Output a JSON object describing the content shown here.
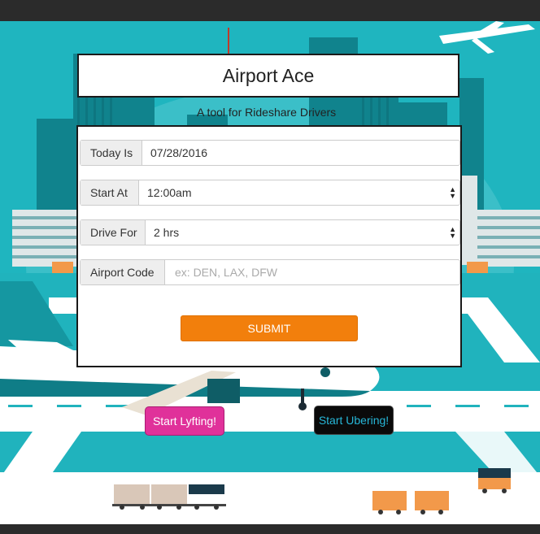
{
  "app": {
    "title": "Airport Ace",
    "subtitle": "A tool for Rideshare Drivers"
  },
  "form": {
    "today": {
      "label": "Today Is",
      "value": "07/28/2016"
    },
    "start": {
      "label": "Start At",
      "value": "12:00am"
    },
    "drive": {
      "label": "Drive For",
      "value": "2 hrs"
    },
    "airport": {
      "label": "Airport Code",
      "value": "",
      "placeholder": "ex: DEN, LAX, DFW"
    },
    "submit_label": "SUBMIT"
  },
  "actions": {
    "lyft_label": "Start Lyfting!",
    "uber_label": "Start Ubering!"
  },
  "colors": {
    "sky": "#1fb5bf",
    "submit": "#f27f0c",
    "lyft": "#e0319a",
    "uber_bg": "#0a0a0a",
    "uber_text": "#27b7d8"
  }
}
